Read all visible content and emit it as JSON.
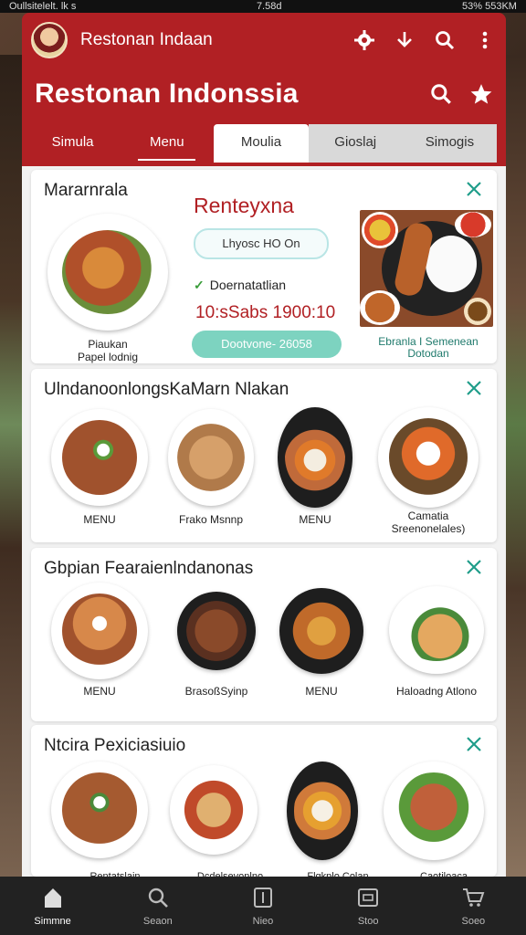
{
  "status": {
    "left": "Oullsitelelt. lk  s",
    "center": "7.58d",
    "right": "53% 553KM"
  },
  "appbar": {
    "title": "Restonan Indaan"
  },
  "header": {
    "big_title": "Restonan Indonssia"
  },
  "tabs": [
    {
      "label": "Simula"
    },
    {
      "label": "Menu"
    },
    {
      "label": "Moulia"
    },
    {
      "label": "Gioslaj"
    },
    {
      "label": "Simogis"
    }
  ],
  "card1": {
    "title": "Mararnrala",
    "dish_caption": "Piaukan\nPapel lodnig",
    "promo_title": "Renteyxna",
    "pill_text": "Lhyosc HO On",
    "check_text": "Doernatatlian",
    "hours": "10:sSabs 1900:10",
    "button_text": "Dootvone- 26058",
    "photo_caption": "Ebranla I Semenean\nDotodan"
  },
  "card2": {
    "title": "UlndanoonlongsKaMarn Nlakan",
    "items": [
      {
        "caption": "MENU"
      },
      {
        "caption": "Frako Msnnp"
      },
      {
        "caption": "MENU"
      },
      {
        "caption": "Camatia\nSreenonelales)"
      }
    ]
  },
  "card3": {
    "title": "Gbpian Fearaienlndanonas",
    "items": [
      {
        "caption": "MENU"
      },
      {
        "caption": "BrasoßSyinp"
      },
      {
        "caption": "MENU"
      },
      {
        "caption": "Haloadng Atlono"
      }
    ]
  },
  "card4": {
    "title": "Ntcira Pexiciasiuio",
    "items": [
      {
        "caption": "Rentatslain\nEhnlolsinar"
      },
      {
        "caption": "Dcdelsevonlno\nlooaseuoonlan"
      },
      {
        "caption": "Flgkplo Colan\nDhnaalnsaren"
      },
      {
        "caption": "Caotiloaca\nIseenaa/Halan"
      }
    ]
  },
  "bottom_nav": [
    {
      "label": "Simmne",
      "icon": "home-icon"
    },
    {
      "label": "Seaon",
      "icon": "search-icon"
    },
    {
      "label": "Nieo",
      "icon": "book-icon"
    },
    {
      "label": "Stoo",
      "icon": "store-icon"
    },
    {
      "label": "Soeo",
      "icon": "cart-icon"
    }
  ],
  "colors": {
    "brand": "#b12024",
    "accent_teal": "#7dd3c0",
    "close_teal": "#1f9d8a"
  }
}
